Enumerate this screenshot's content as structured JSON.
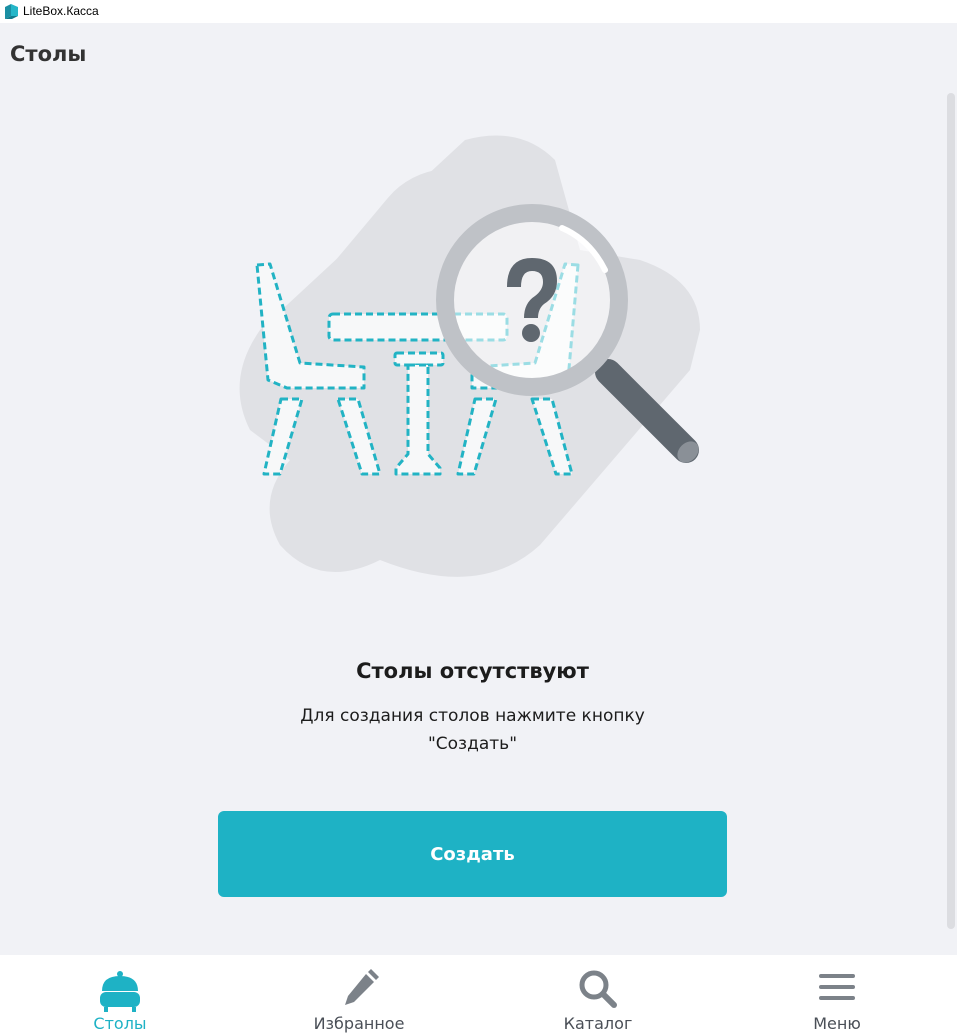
{
  "window": {
    "title": "LiteBox.Касса"
  },
  "page": {
    "title": "Столы"
  },
  "empty_state": {
    "title": "Столы отсутствуют",
    "description_line1": "Для создания столов нажмите кнопку",
    "description_line2": "\"Создать\"",
    "create_button_label": "Создать"
  },
  "nav": {
    "items": [
      {
        "label": "Столы",
        "icon": "service-bell-icon",
        "active": true
      },
      {
        "label": "Избранное",
        "icon": "pencil-icon",
        "active": false
      },
      {
        "label": "Каталог",
        "icon": "search-icon",
        "active": false
      },
      {
        "label": "Меню",
        "icon": "hamburger-menu-icon",
        "active": false
      }
    ]
  },
  "colors": {
    "accent": "#1eb2c5",
    "background": "#f1f2f6",
    "text": "#1c1c1c",
    "nav_inactive": "#4a4f57"
  }
}
